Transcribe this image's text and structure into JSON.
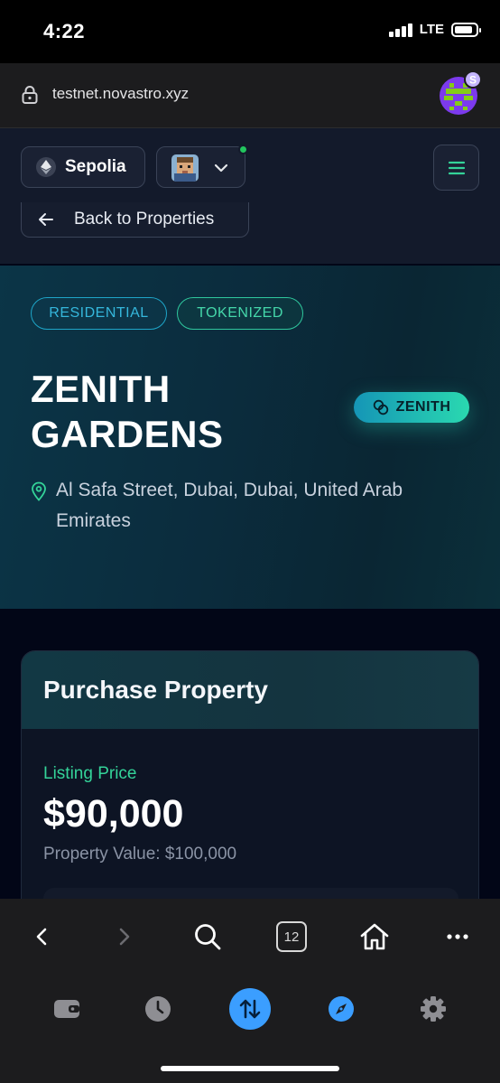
{
  "status_bar": {
    "time": "4:22",
    "network": "LTE",
    "battery_level": 0.85
  },
  "browser": {
    "url": "testnet.novastro.xyz",
    "extension_badge": "S",
    "tab_count": "12"
  },
  "header": {
    "network_label": "Sepolia",
    "back_label": "Back to Properties"
  },
  "hero": {
    "tags": [
      "RESIDENTIAL",
      "TOKENIZED"
    ],
    "title": "ZENITH GARDENS",
    "token_symbol": "ZENITH",
    "location": "Al Safa Street, Dubai, Dubai, United Arab Emirates"
  },
  "purchase": {
    "title": "Purchase Property",
    "listing_label": "Listing Price",
    "listing_price": "$90,000",
    "property_value": "Property Value: $100,000"
  },
  "browser_toolbar": [
    "back-icon",
    "forward-icon",
    "search-icon",
    "tabs-icon",
    "home-icon",
    "more-icon"
  ],
  "wallet_nav": [
    "wallet-icon",
    "history-icon",
    "swap-icon",
    "explore-icon",
    "settings-icon"
  ],
  "colors": {
    "accent_green": "#34d399",
    "accent_blue": "#3b9eff",
    "tag_blue": "#35b7dc",
    "tag_green": "#45d7aa"
  }
}
